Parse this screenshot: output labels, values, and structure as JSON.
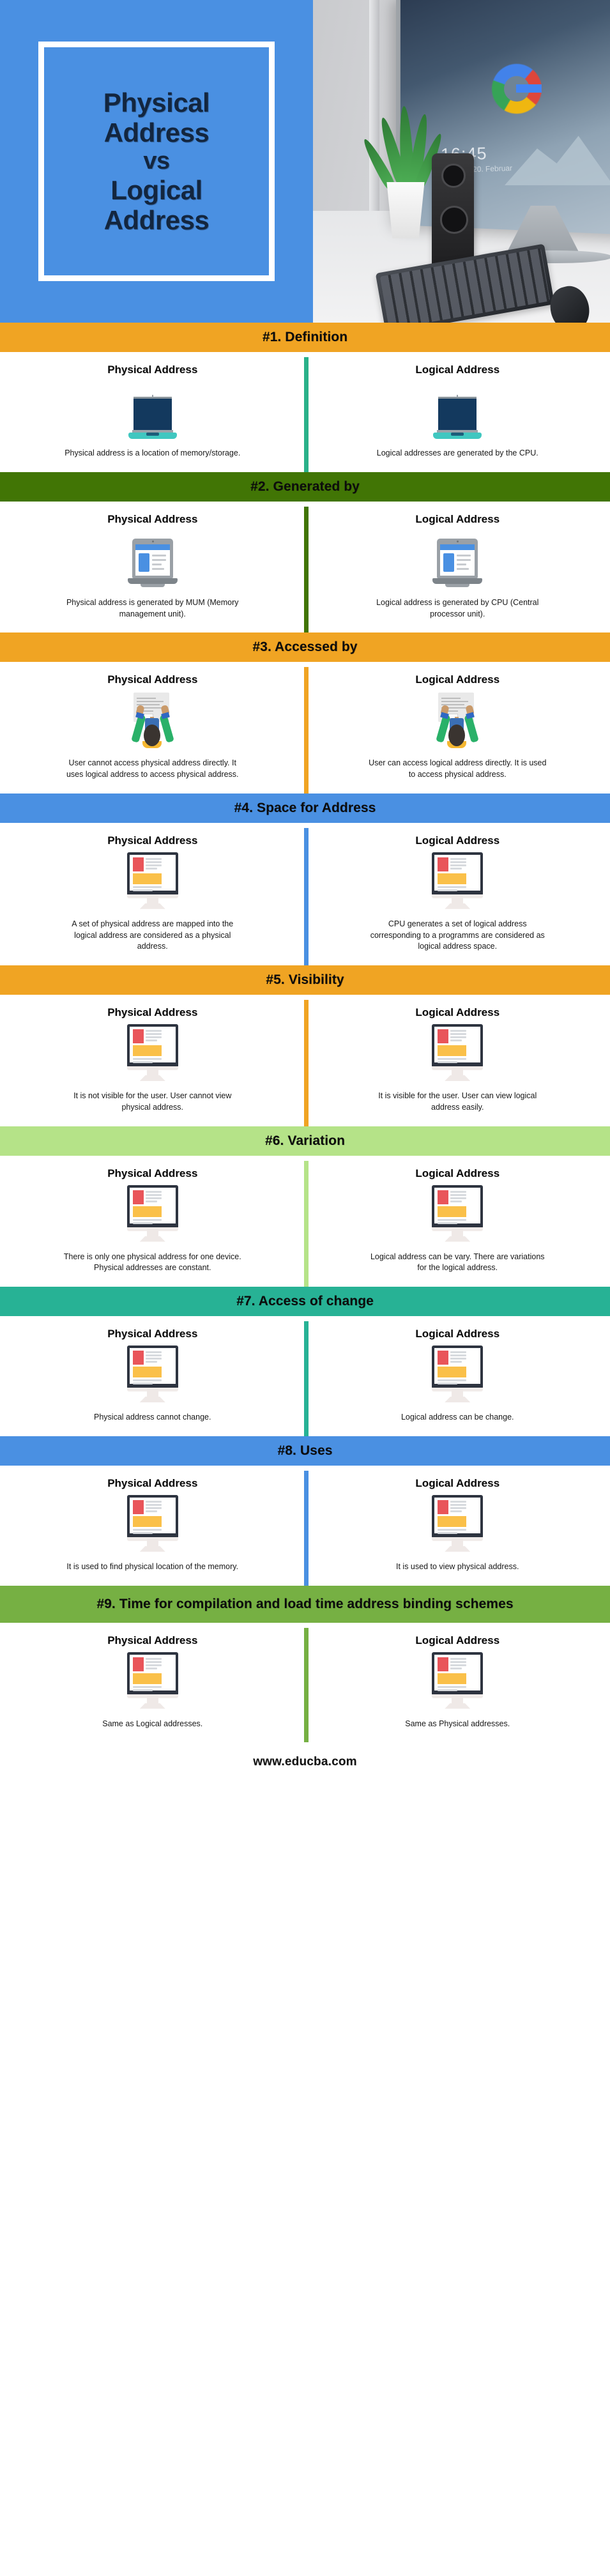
{
  "header": {
    "title_lines": [
      "Physical",
      "Address",
      "vs",
      "Logical",
      "Address"
    ],
    "background_color": "#4a90e2",
    "photo": {
      "alt_name": "desk-with-monitor-keyboard-plant-speaker",
      "screen_clock": "16:45",
      "screen_date": "Mittwoch, 20. Februar",
      "screen_logo": "google-g-logo"
    }
  },
  "column_labels": {
    "physical": "Physical Address",
    "logical": "Logical Address"
  },
  "sections": [
    {
      "id": 1,
      "band_label": "#1. Definition",
      "band_color": "#f0a423",
      "divider_color": "#2ab189",
      "icon": "dark-laptop-icon",
      "physical_text": "Physical address is a location of memory/storage.",
      "logical_text": "Logical addresses are generated by the CPU."
    },
    {
      "id": 2,
      "band_label": "#2. Generated by",
      "band_color": "#417505",
      "divider_color": "#417505",
      "icon": "laptop-webpage-icon",
      "physical_text": "Physical address is generated by MUM (Memory management unit).",
      "logical_text": "Logical address is generated by CPU (Central processor unit)."
    },
    {
      "id": 3,
      "band_label": "#3. Accessed by",
      "band_color": "#f0a423",
      "divider_color": "#f0a423",
      "icon": "person-raising-hands-icon",
      "physical_text": "User cannot access physical address directly. It uses logical address to access physical address.",
      "logical_text": "User can access logical address directly. It is used to access physical address."
    },
    {
      "id": 4,
      "band_label": "#4. Space for Address",
      "band_color": "#4a90e2",
      "divider_color": "#4a90e2",
      "icon": "desktop-monitor-icon",
      "physical_text": "A set of physical address are mapped into the logical address are considered as a physical address.",
      "logical_text": "CPU generates a set of logical address corresponding to a programms are considered as logical address space."
    },
    {
      "id": 5,
      "band_label": "#5. Visibility",
      "band_color": "#f0a423",
      "divider_color": "#f0a423",
      "icon": "desktop-monitor-icon",
      "physical_text": "It is not visible for the user. User cannot view physical address.",
      "logical_text": "It is visible for the user. User can view logical address easily."
    },
    {
      "id": 6,
      "band_label": "#6. Variation",
      "band_color": "#b5e388",
      "divider_color": "#b5e388",
      "icon": "desktop-monitor-icon",
      "physical_text": "There is only one physical address for one device. Physical addresses are constant.",
      "logical_text": "Logical address can be vary. There are variations for the logical address."
    },
    {
      "id": 7,
      "band_label": "#7. Access of change",
      "band_color": "#27b295",
      "divider_color": "#27b295",
      "icon": "desktop-monitor-icon",
      "physical_text": "Physical address cannot change.",
      "logical_text": "Logical address can be change."
    },
    {
      "id": 8,
      "band_label": "#8. Uses",
      "band_color": "#4a90e2",
      "divider_color": "#4a90e2",
      "icon": "desktop-monitor-icon",
      "physical_text": "It is used to find physical location of the memory.",
      "logical_text": "It is used to view physical address."
    },
    {
      "id": 9,
      "band_label": "#9. Time for compilation and load time address binding schemes",
      "band_color": "#76b043",
      "divider_color": "#76b043",
      "icon": "desktop-monitor-icon",
      "physical_text": "Same as Logical addresses.",
      "logical_text": "Same as Physical addresses."
    }
  ],
  "footer": {
    "url": "www.educba.com"
  }
}
